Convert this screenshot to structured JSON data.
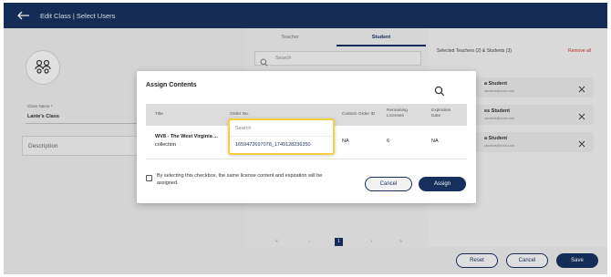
{
  "header": {
    "title": "Edit Class | Select Users"
  },
  "left": {
    "class_name_label": "Class Name *",
    "class_name_value": "Lanie's Class",
    "description_placeholder": "Description"
  },
  "tabs": [
    {
      "label": "Teacher"
    },
    {
      "label": "Student"
    }
  ],
  "search": {
    "placeholder": "Search"
  },
  "pagination": [
    "1"
  ],
  "selected": {
    "title": "Selected Teachers (2) & Students (3)",
    "remove_all": "Remove all",
    "items": [
      {
        "name": "a Student",
        "email": "student@mail.com"
      },
      {
        "name": "es Student",
        "email": "student@mail.com"
      },
      {
        "name": "a Student",
        "email": "student@mail.com"
      }
    ]
  },
  "modal": {
    "title": "Assign Contents",
    "columns": [
      "Title",
      "Order No.",
      "Custom Order ID",
      "Remaining Licenses",
      "Expiration Date"
    ],
    "row": {
      "title_bold": "WV8 - The West Virginia ...",
      "title_sub": "collection",
      "custom_order_id": "NA",
      "remaining": "6",
      "expiration": "NA"
    },
    "checkbox_label": "By selecting this checkbox, the same license content and expiration will be assigned.",
    "cancel": "Cancel",
    "assign": "Assign"
  },
  "dropdown": {
    "search_placeholder": "Search",
    "option": "1659472697078_1749128236350"
  },
  "footer": {
    "reset": "Reset",
    "cancel": "Cancel",
    "save": "Save"
  },
  "colors": {
    "primary": "#17305e",
    "highlight": "#f4d03f",
    "danger": "#cc3333"
  }
}
